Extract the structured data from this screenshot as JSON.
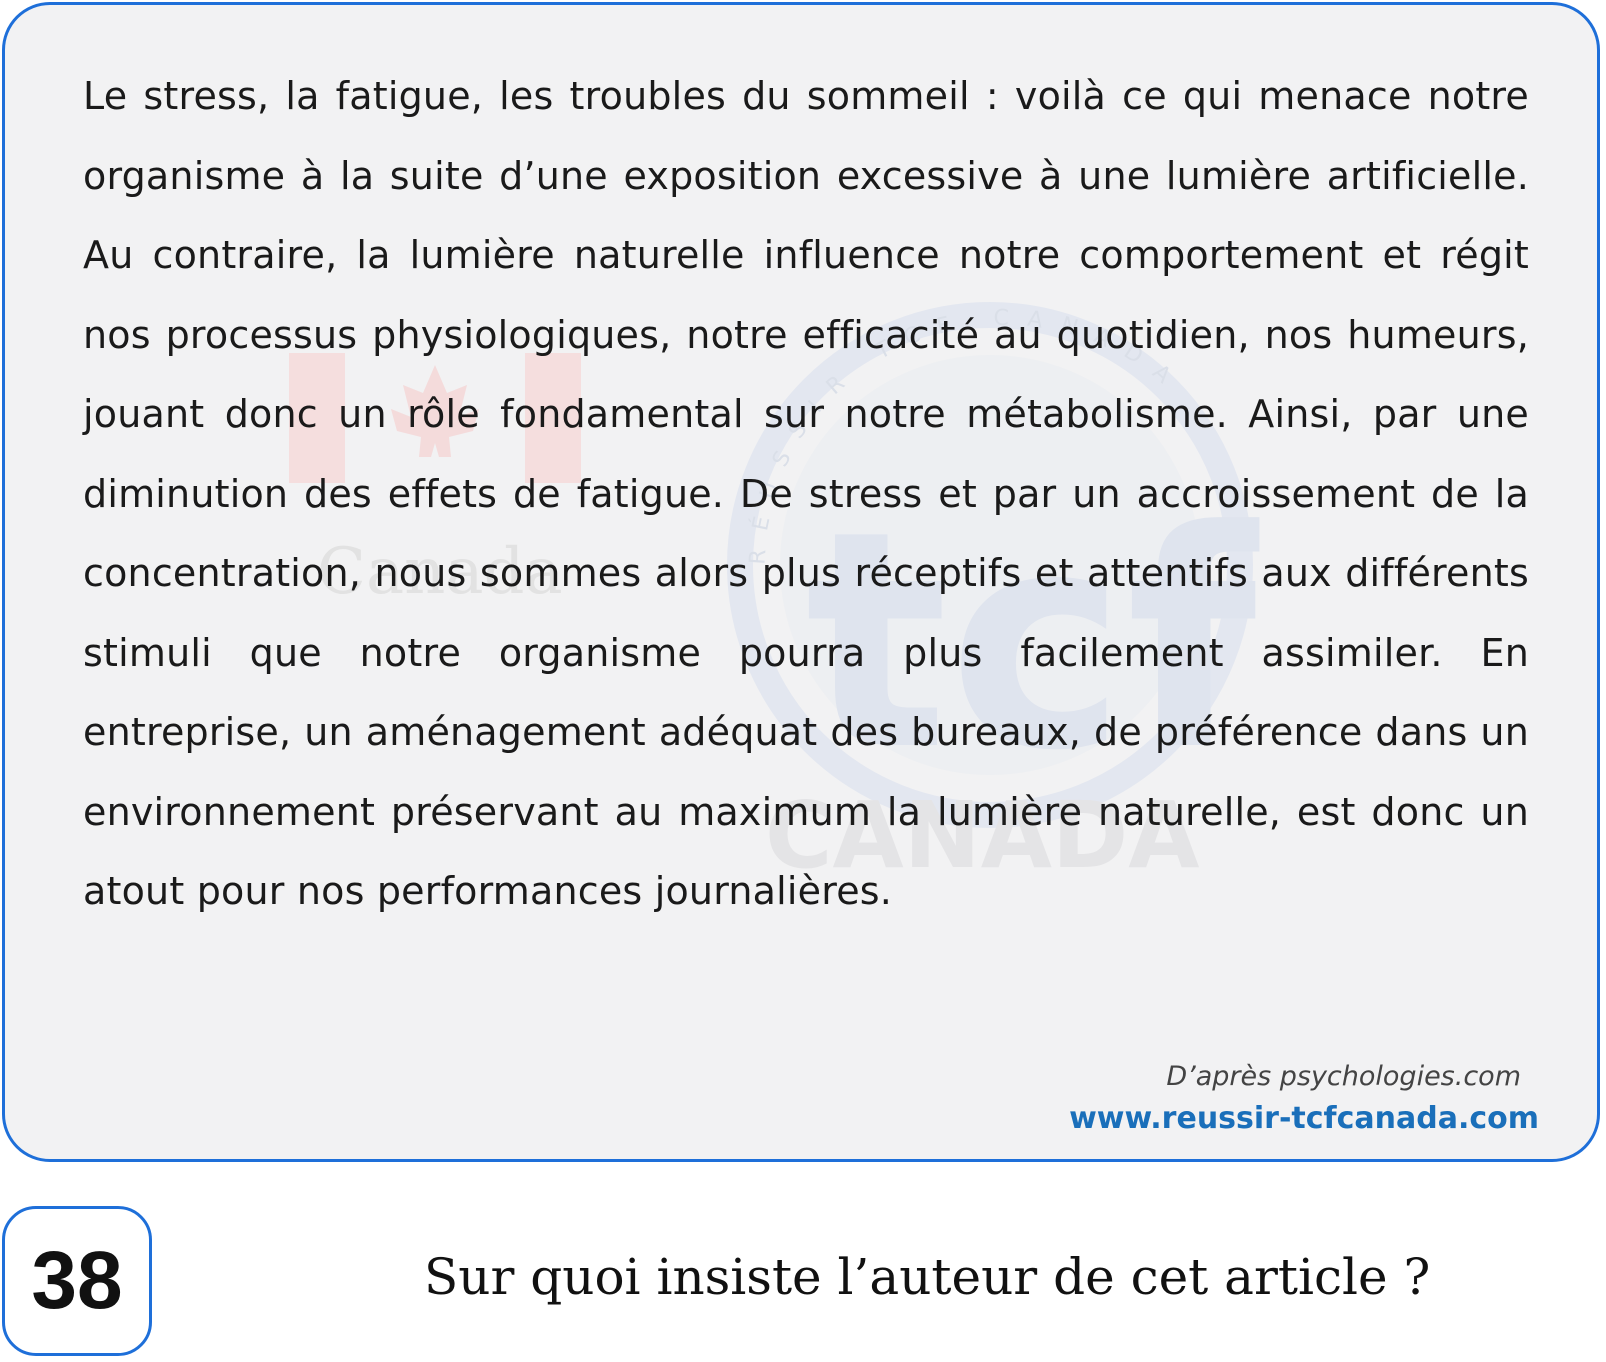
{
  "passage": {
    "text": "Le stress, la fatigue, les troubles du sommeil : voilà ce qui menace notre organisme à la suite d’une exposition excessive à une lumière artificielle. Au contraire, la lumière naturelle influence notre comportement et régit nos processus physiologiques, notre efficacité au quotidien, nos humeurs, jouant donc un rôle fondamental sur notre métabolisme. Ainsi, par une diminution des effets de fatigue. De stress et par un accroissement de la concentration, nous sommes alors plus réceptifs et attentifs aux différents stimuli que notre organisme pourra plus facilement assimiler. En entreprise, un aménagement adéquat des bureaux, de préférence dans un environnement préservant au maximum la lumière naturelle, est donc un atout pour nos performances journalières.",
    "source": "D’après psychologies.com",
    "website": "www.reussir-tcfcanada.com"
  },
  "watermark": {
    "flag_word": "Canada",
    "logo_word": "tcf",
    "logo_subword": "CANADA",
    "ring_text": "RÉUSSIR TCF CANADA",
    "colors": {
      "flag_red": "#f4dada",
      "logo_blue": "#dfe4ef"
    }
  },
  "question": {
    "number": "38",
    "text": "Sur quoi insiste l’auteur de cet article ?"
  },
  "colors": {
    "accent_border": "#1e6fd9",
    "link": "#1a6fba",
    "card_background": "#f2f2f3"
  }
}
